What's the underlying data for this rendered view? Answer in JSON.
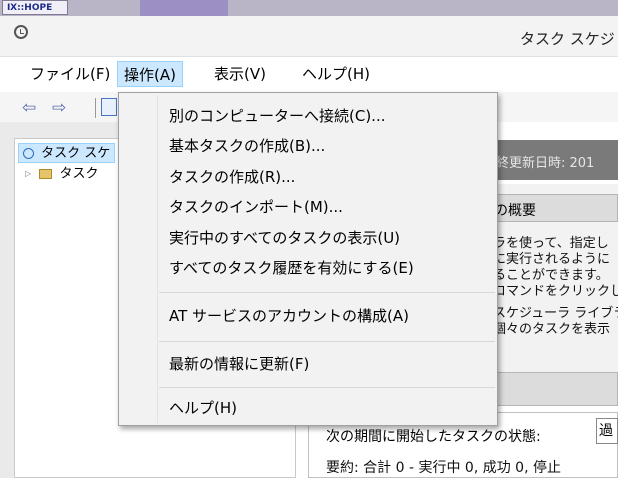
{
  "desktop": {
    "icon_label": "Ⅸ::HOPE"
  },
  "window": {
    "title": "タスク スケジ"
  },
  "menubar": {
    "items": [
      {
        "label": "ファイル(F)"
      },
      {
        "label": "操作(A)"
      },
      {
        "label": "表示(V)"
      },
      {
        "label": "ヘルプ(H)"
      }
    ]
  },
  "tree": {
    "items": [
      {
        "label": "タスク スケ"
      },
      {
        "label": "タスク"
      }
    ]
  },
  "content": {
    "header_text": "終更新日時: 201",
    "summary_label": "の概要",
    "description_lines": [
      "ラを使って、指定し",
      "に実行されるように",
      "ることができます。",
      "コマンドをクリックし",
      "スケジューラ ライブラ",
      "個々のタスクを表示"
    ],
    "status_label": "次の期間に開始したタスクの状態:",
    "status_value": "過",
    "totals_line": "要約: 合計 0 - 実行中 0, 成功 0, 停止"
  },
  "action_menu": {
    "items": [
      {
        "label": "別のコンピューターへ接続(C)..."
      },
      {
        "label": "基本タスクの作成(B)..."
      },
      {
        "label": "タスクの作成(R)..."
      },
      {
        "label": "タスクのインポート(M)..."
      },
      {
        "label": "実行中のすべてのタスクの表示(U)"
      },
      {
        "label": "すべてのタスク履歴を有効にする(E)"
      },
      {
        "label": "AT サービスのアカウントの構成(A)"
      },
      {
        "label": "最新の情報に更新(F)"
      },
      {
        "label": "ヘルプ(H)"
      }
    ]
  }
}
